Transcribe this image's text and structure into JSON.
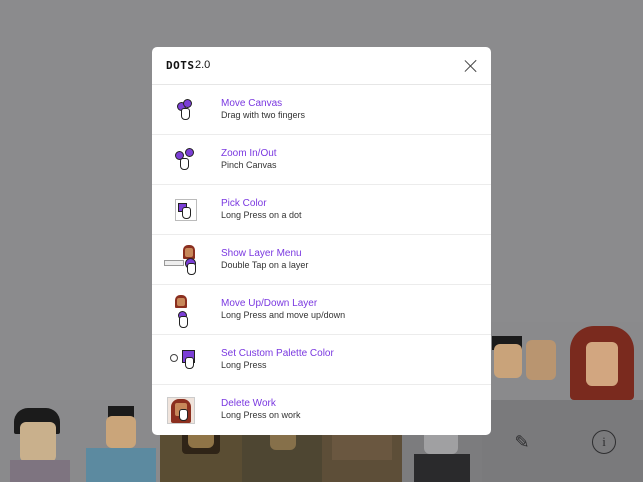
{
  "app": {
    "logo": "DOTS",
    "version": "2.0"
  },
  "help_items": [
    {
      "title": "Move Canvas",
      "subtitle": "Drag with two fingers",
      "icon": "two-finger-drag-icon"
    },
    {
      "title": "Zoom In/Out",
      "subtitle": "Pinch Canvas",
      "icon": "pinch-icon"
    },
    {
      "title": "Pick Color",
      "subtitle": "Long Press on a dot",
      "icon": "pick-color-icon"
    },
    {
      "title": "Show Layer Menu",
      "subtitle": "Double Tap on a layer",
      "icon": "layer-menu-icon"
    },
    {
      "title": "Move Up/Down Layer",
      "subtitle": "Long Press and move up/down",
      "icon": "move-layer-icon"
    },
    {
      "title": "Set Custom Palette Color",
      "subtitle": "Long Press",
      "icon": "palette-color-icon"
    },
    {
      "title": "Delete Work",
      "subtitle": "Long Press on work",
      "icon": "delete-work-icon"
    }
  ],
  "toolbar": {
    "edit_icon": "edit-icon",
    "info_icon": "info-icon",
    "info_glyph": "i"
  },
  "colors": {
    "accent": "#7a38e0",
    "overlay": "#8b8b8d"
  }
}
